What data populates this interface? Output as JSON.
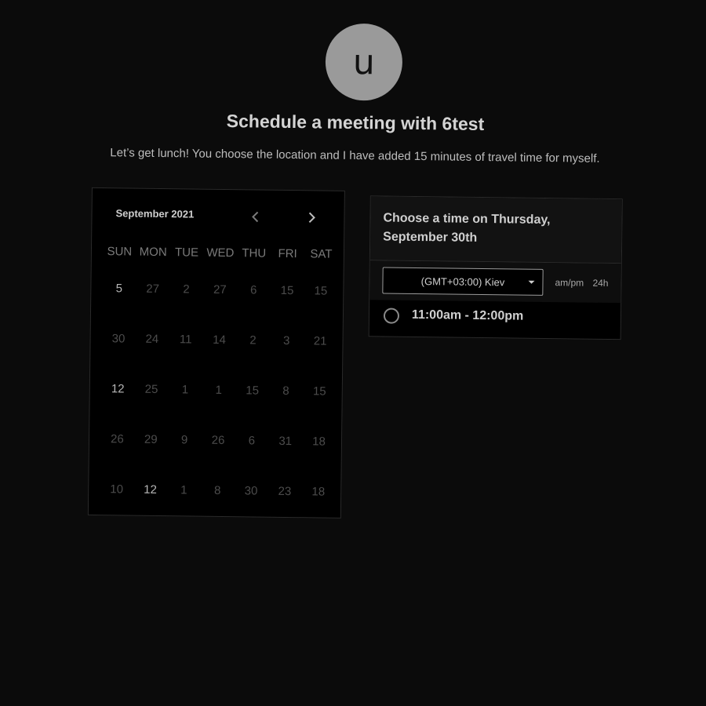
{
  "host": {
    "avatar_letter": "u",
    "title": "Schedule a meeting with 6test",
    "description": "Let’s get lunch! You choose the location and I have added 15 minutes of travel time for myself."
  },
  "calendar": {
    "month_label": "September 2021",
    "prev_icon": "chevron-left-icon",
    "next_icon": "chevron-right-icon",
    "weekdays": [
      "SUN",
      "MON",
      "TUE",
      "WED",
      "THU",
      "FRI",
      "SAT"
    ],
    "days": [
      {
        "label": "5",
        "active": true
      },
      {
        "label": "27",
        "active": false
      },
      {
        "label": "2",
        "active": false
      },
      {
        "label": "27",
        "active": false
      },
      {
        "label": "6",
        "active": false
      },
      {
        "label": "15",
        "active": false
      },
      {
        "label": "15",
        "active": false
      },
      {
        "label": "30",
        "active": false
      },
      {
        "label": "24",
        "active": false
      },
      {
        "label": "11",
        "active": false
      },
      {
        "label": "14",
        "active": false
      },
      {
        "label": "2",
        "active": false
      },
      {
        "label": "3",
        "active": false
      },
      {
        "label": "21",
        "active": false
      },
      {
        "label": "12",
        "active": true
      },
      {
        "label": "25",
        "active": false
      },
      {
        "label": "1",
        "active": false
      },
      {
        "label": "1",
        "active": false
      },
      {
        "label": "15",
        "active": false
      },
      {
        "label": "8",
        "active": false
      },
      {
        "label": "15",
        "active": false
      },
      {
        "label": "26",
        "active": false
      },
      {
        "label": "29",
        "active": false
      },
      {
        "label": "9",
        "active": false
      },
      {
        "label": "26",
        "active": false
      },
      {
        "label": "6",
        "active": false
      },
      {
        "label": "31",
        "active": false
      },
      {
        "label": "18",
        "active": false
      },
      {
        "label": "10",
        "active": false
      },
      {
        "label": "12",
        "active": true
      },
      {
        "label": "1",
        "active": false
      },
      {
        "label": "8",
        "active": false
      },
      {
        "label": "30",
        "active": false
      },
      {
        "label": "23",
        "active": false
      },
      {
        "label": "18",
        "active": false
      }
    ]
  },
  "times": {
    "heading": "Choose a time on Thursday, September 30th",
    "timezone": "(GMT+03:00) Kiev",
    "format_ampm": "am/pm",
    "format_24h": "24h",
    "slots": [
      {
        "label": "11:00am - 12:00pm"
      }
    ]
  }
}
